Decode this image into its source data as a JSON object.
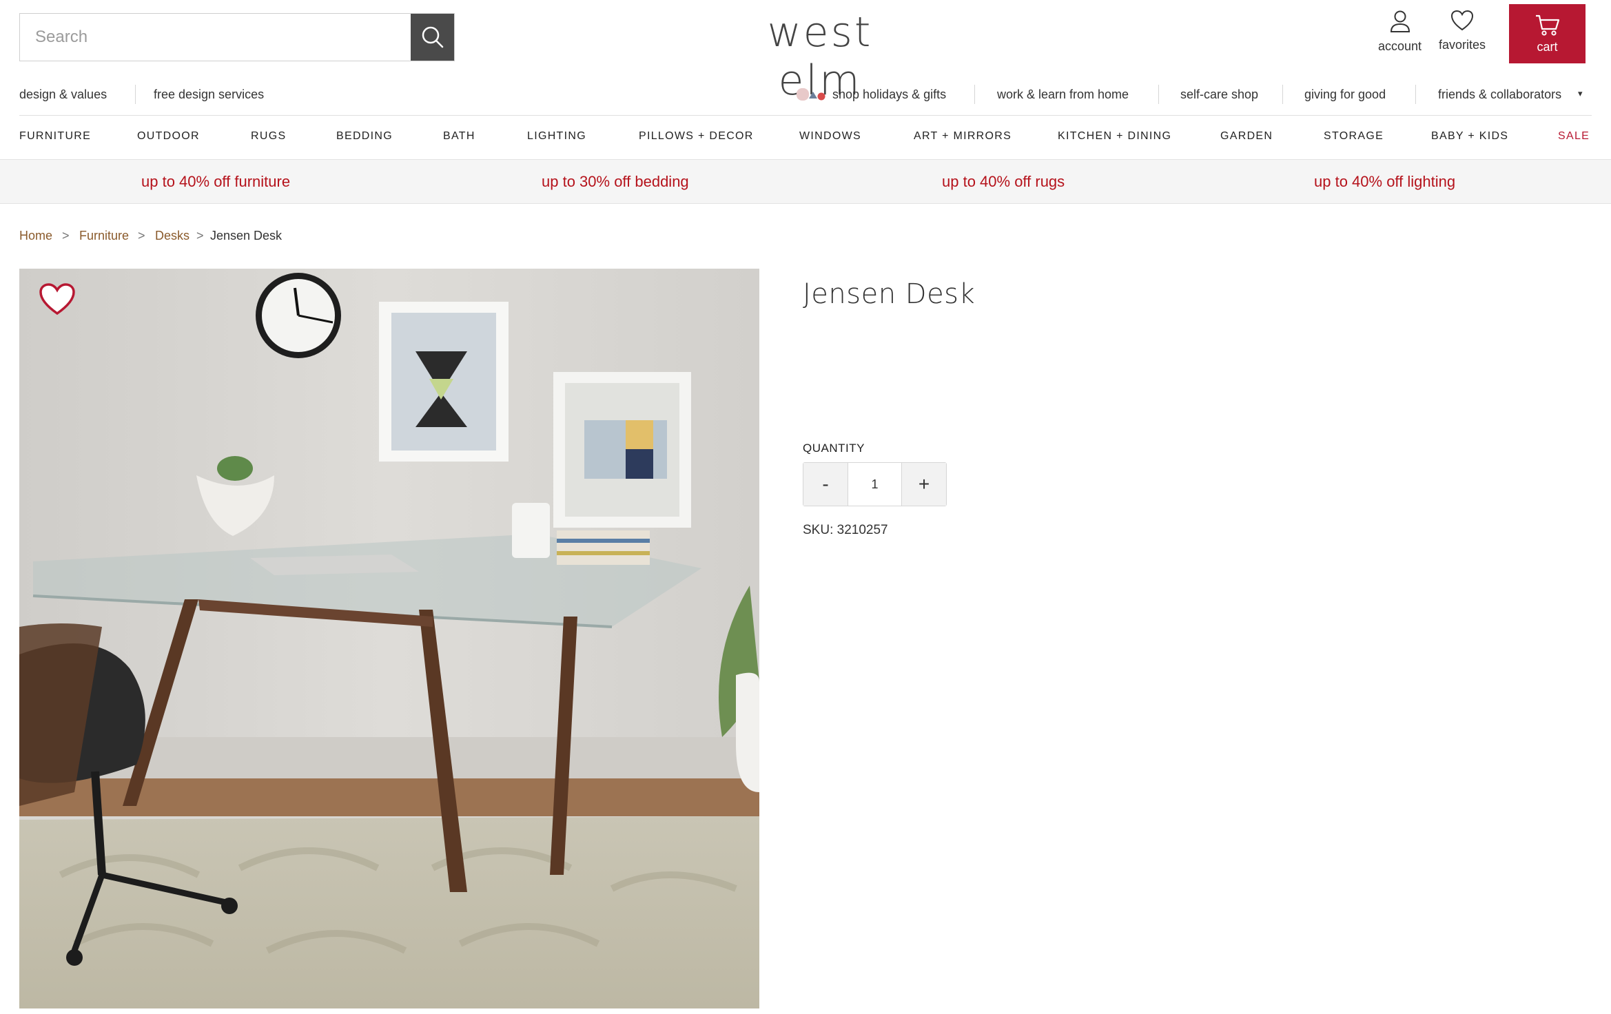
{
  "header": {
    "search_placeholder": "Search",
    "logo": "west elm",
    "account_label": "account",
    "favorites_label": "favorites",
    "cart_label": "cart",
    "brand_color": "#b71832"
  },
  "secondary_nav": {
    "left": [
      "design & values",
      "free design services"
    ],
    "right": [
      "shop holidays & gifts",
      "work & learn from home",
      "self-care shop",
      "giving for good",
      "friends & collaborators"
    ],
    "dropdown_glyph": "▾"
  },
  "main_nav": [
    "FURNITURE",
    "OUTDOOR",
    "RUGS",
    "BEDDING",
    "BATH",
    "LIGHTING",
    "PILLOWS + DECOR",
    "WINDOWS",
    "ART + MIRRORS",
    "KITCHEN + DINING",
    "GARDEN",
    "STORAGE",
    "BABY + KIDS",
    "SALE"
  ],
  "promos": [
    "up to 40% off furniture",
    "up to 30% off bedding",
    "up to 40% off rugs",
    "up to 40% off lighting"
  ],
  "breadcrumb": {
    "items": [
      "Home",
      "Furniture",
      "Desks"
    ],
    "current": "Jensen Desk",
    "separator": ">"
  },
  "product": {
    "title": "Jensen Desk",
    "quantity_label": "QUANTITY",
    "quantity_value": "1",
    "minus_label": "-",
    "plus_label": "+",
    "sku": "SKU: 3210257",
    "image_icon": "product-photo-desk",
    "favorite_icon": "heart-icon"
  }
}
